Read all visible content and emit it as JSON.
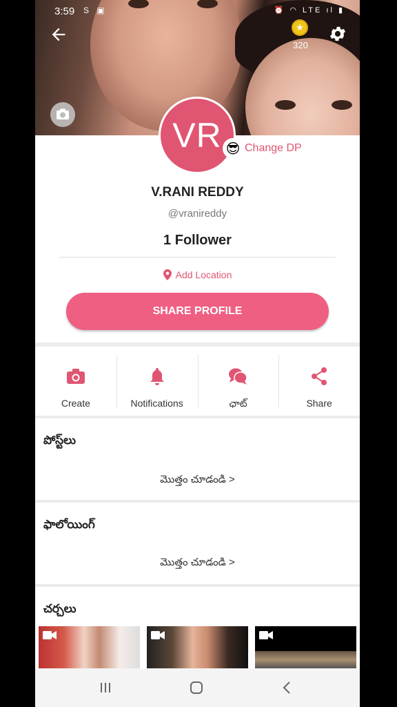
{
  "status_bar": {
    "time": "3:59",
    "left_icons": "S ▣",
    "right_icons": "⏰ ◠ LTE ıl ▮"
  },
  "header": {
    "coins": "320"
  },
  "profile": {
    "initials": "VR",
    "change_dp_label": "Change DP",
    "change_dp_emoji": "😎",
    "name": "V.RANI REDDY",
    "handle": "@vranireddy",
    "followers": "1 Follower",
    "add_location": "Add Location",
    "share_profile": "SHARE PROFILE"
  },
  "actions": [
    {
      "label": "Create",
      "icon": "camera-icon"
    },
    {
      "label": "Notifications",
      "icon": "bell-icon"
    },
    {
      "label": "ఛాట్",
      "icon": "chat-icon"
    },
    {
      "label": "Share",
      "icon": "share-icon"
    }
  ],
  "sections": {
    "posts": {
      "title": "పోస్ట్‌లు",
      "more": "మొత్తం చూడండి >"
    },
    "following": {
      "title": "ఫాలోయింగ్",
      "more": "మొత్తం చూడండి >"
    },
    "chats": {
      "title": "చర్చలు"
    }
  },
  "colors": {
    "accent": "#e05572",
    "button": "#ef5f82"
  }
}
